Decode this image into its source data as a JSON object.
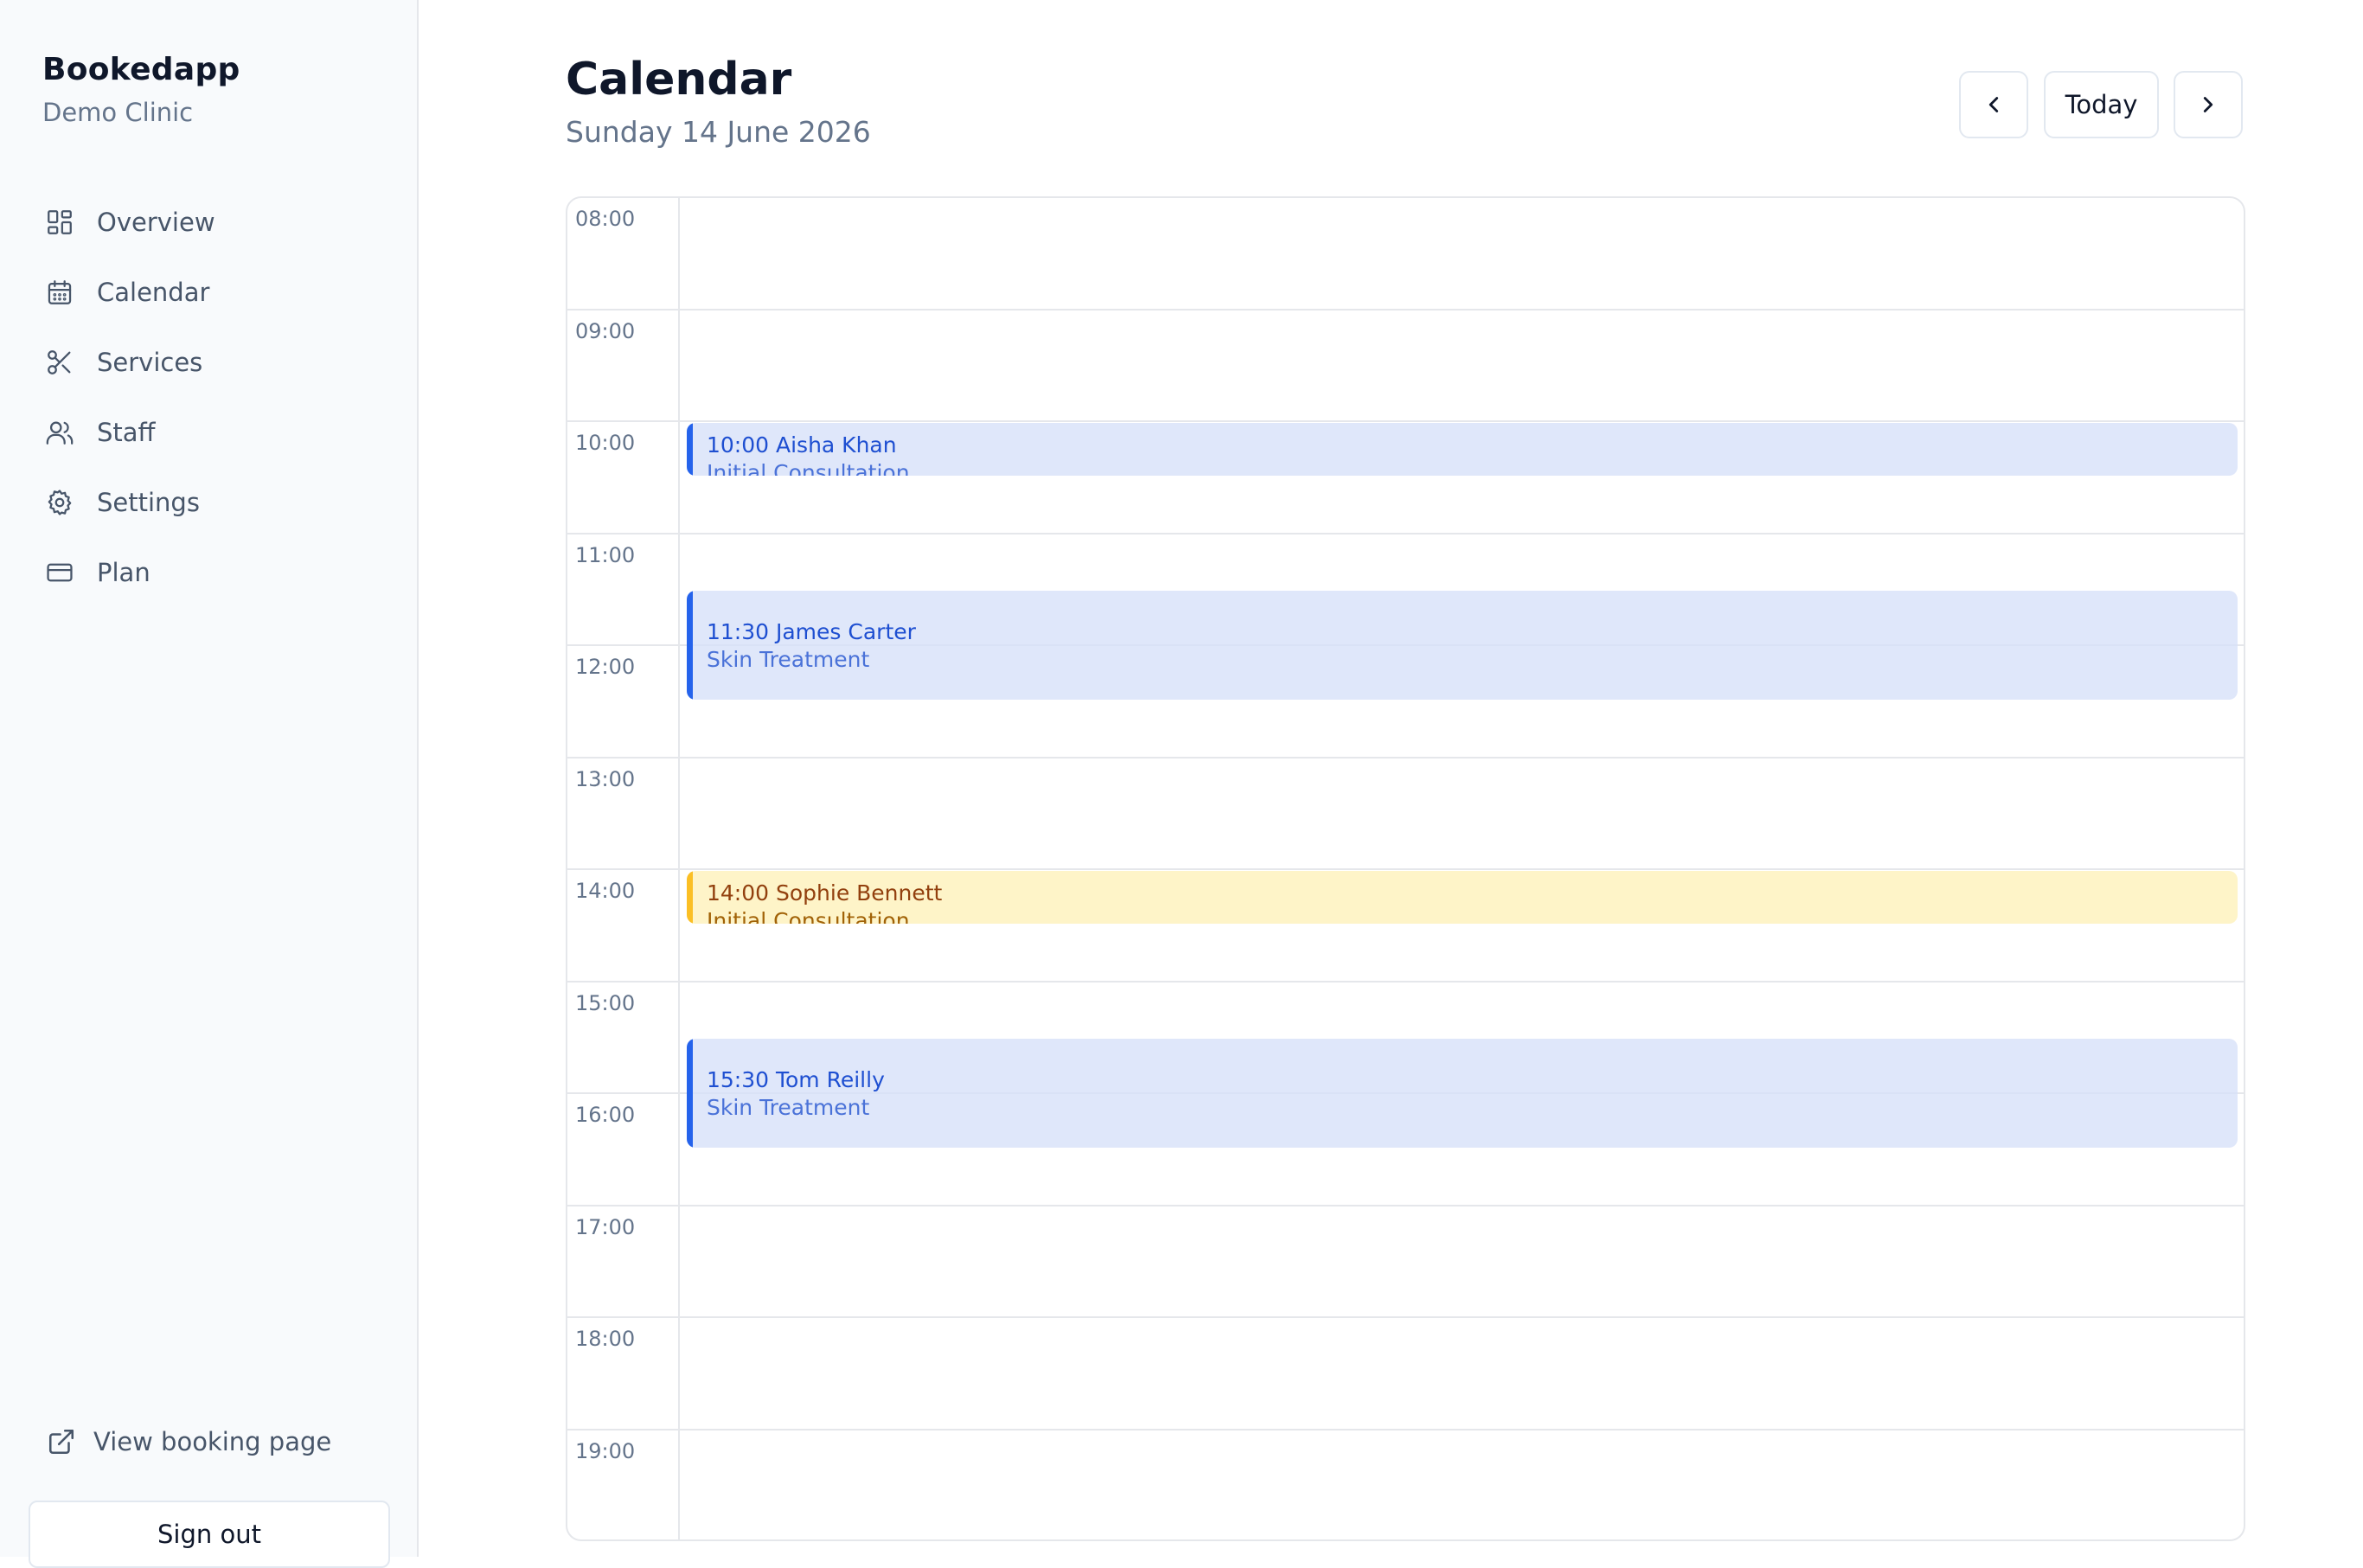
{
  "sidebar": {
    "brand": "Bookedapp",
    "clinic": "Demo Clinic",
    "items": [
      {
        "label": "Overview",
        "icon": "grid-icon"
      },
      {
        "label": "Calendar",
        "icon": "calendar-icon"
      },
      {
        "label": "Services",
        "icon": "scissors-icon"
      },
      {
        "label": "Staff",
        "icon": "users-icon"
      },
      {
        "label": "Settings",
        "icon": "gear-icon"
      },
      {
        "label": "Plan",
        "icon": "credit-card-icon"
      }
    ],
    "view_booking": "View booking page",
    "sign_out": "Sign out"
  },
  "header": {
    "title": "Calendar",
    "date": "Sunday 14 June 2026",
    "today_label": "Today"
  },
  "calendar": {
    "hours": [
      "08:00",
      "09:00",
      "10:00",
      "11:00",
      "12:00",
      "13:00",
      "14:00",
      "15:00",
      "16:00",
      "17:00",
      "18:00",
      "19:00"
    ],
    "events": [
      {
        "name": "10:00 Aisha Khan",
        "service": "Initial Consultation",
        "start": "10:00",
        "end": "10:30",
        "color": "blue"
      },
      {
        "name": "11:30 James Carter",
        "service": "Skin Treatment",
        "start": "11:30",
        "end": "12:30",
        "color": "blue"
      },
      {
        "name": "14:00 Sophie Bennett",
        "service": "Initial Consultation",
        "start": "14:00",
        "end": "14:30",
        "color": "yellow"
      },
      {
        "name": "15:30 Tom Reilly",
        "service": "Skin Treatment",
        "start": "15:30",
        "end": "16:30",
        "color": "blue"
      }
    ]
  },
  "colors": {
    "accent_blue": "#2563eb",
    "accent_yellow": "#fbbf24",
    "event_blue_bg": "#dfe7fb",
    "event_yellow_bg": "#fef3c7"
  }
}
